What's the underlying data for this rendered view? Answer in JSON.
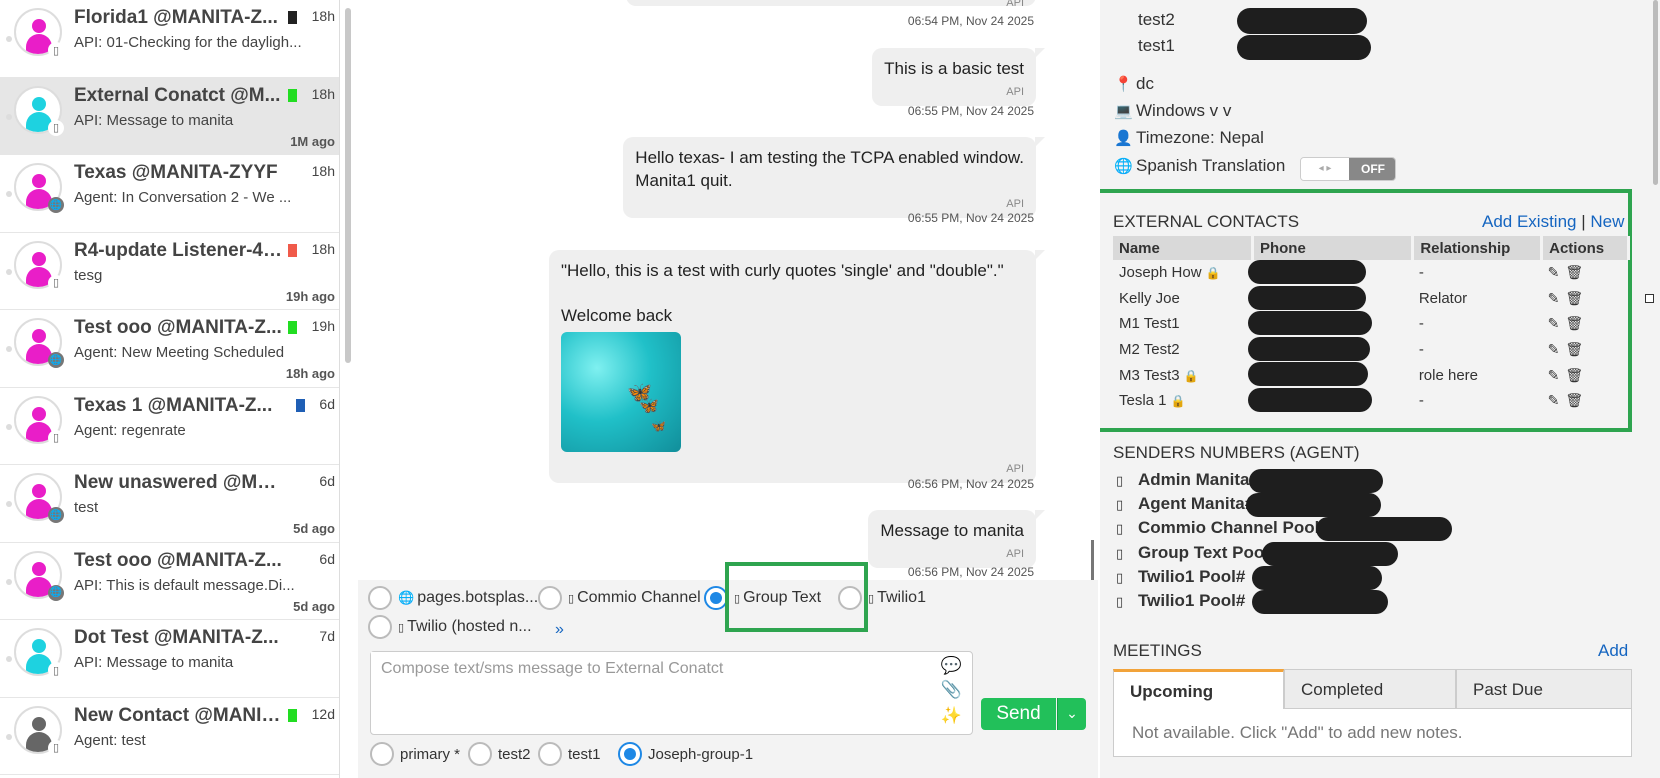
{
  "conversations": [
    {
      "title": "Florida1 @MANITA-Z...",
      "preview": "API: 01-Checking for the dayligh...",
      "time": "18h",
      "ago": "",
      "avatar_color": "#e91ec8",
      "flag_color": "#222222",
      "channel_icon": "phone-icon",
      "active": false
    },
    {
      "title": "External Conatct @M...",
      "preview": "API: Message to manita",
      "time": "18h",
      "ago": "1M ago",
      "avatar_color": "#1ed2e0",
      "flag_color": "#22dd22",
      "channel_icon": "phone-icon",
      "active": true
    },
    {
      "title": "Texas @MANITA-ZYYF",
      "preview": "Agent: In Conversation 2 - We ...",
      "time": "18h",
      "ago": "",
      "avatar_color": "#e91ec8",
      "flag_color": "",
      "channel_icon": "globe-icon",
      "active": false
    },
    {
      "title": "R4-update Listener-4 ...",
      "preview": "tesg",
      "time": "18h",
      "ago": "19h ago",
      "avatar_color": "#e91ec8",
      "flag_color": "#f05a4a",
      "channel_icon": "phone-icon",
      "active": false
    },
    {
      "title": "Test ooo @MANITA-Z...",
      "preview": "Agent: New Meeting Scheduled",
      "time": "19h",
      "ago": "18h ago",
      "avatar_color": "#e91ec8",
      "flag_color": "#22dd22",
      "channel_icon": "globe-icon",
      "active": false
    },
    {
      "title": "Texas 1 @MANITA-Z...",
      "preview": "Agent: regenrate",
      "time": "6d",
      "ago": "",
      "avatar_color": "#e91ec8",
      "flag_color": "#1f5fb5",
      "channel_icon": "phone-icon",
      "active": false
    },
    {
      "title": "New unaswered @MA...",
      "preview": "test",
      "time": "6d",
      "ago": "5d ago",
      "avatar_color": "#e91ec8",
      "flag_color": "",
      "channel_icon": "globe-icon",
      "active": false
    },
    {
      "title": "Test ooo @MANITA-Z...",
      "preview": "API: This is default message.Di...",
      "time": "6d",
      "ago": "5d ago",
      "avatar_color": "#e91ec8",
      "flag_color": "",
      "channel_icon": "globe-icon",
      "active": false
    },
    {
      "title": "Dot Test @MANITA-Z...",
      "preview": "API: Message to manita",
      "time": "7d",
      "ago": "",
      "avatar_color": "#1ed2e0",
      "flag_color": "",
      "channel_icon": "phone-icon",
      "active": false
    },
    {
      "title": "New Contact @MANIT...",
      "preview": "Agent: test",
      "time": "12d",
      "ago": "",
      "avatar_color": "#666666",
      "flag_color": "#22dd22",
      "channel_icon": "phone-icon",
      "active": false
    }
  ],
  "messages": {
    "m0": {
      "api": "API",
      "stamp": "06:54 PM, Nov 24 2025"
    },
    "m1": {
      "text": "This is a basic test",
      "api": "API",
      "stamp": "06:55 PM, Nov 24 2025"
    },
    "m2": {
      "line1": "Hello texas- I am testing the TCPA enabled window.",
      "line2": "Manita1 quit.",
      "api": "API",
      "stamp": "06:55 PM, Nov 24 2025"
    },
    "m3": {
      "line1": "\"Hello, this is a test with curly quotes 'single' and \"double\".\"",
      "line2": "Welcome back",
      "api": "API",
      "stamp": "06:56 PM, Nov 24 2025"
    },
    "m4": {
      "text": "Message to manita",
      "api": "API",
      "stamp": "06:56 PM, Nov 24 2025"
    }
  },
  "channels": [
    {
      "label": "pages.botsplas...",
      "icon": "globe-icon",
      "selected": false
    },
    {
      "label": "Commio Channel",
      "icon": "phone-icon",
      "selected": false
    },
    {
      "label": "Group Text",
      "icon": "phone-icon",
      "selected": true
    },
    {
      "label": "Twilio1",
      "icon": "phone-icon",
      "selected": false
    },
    {
      "label": "Twilio (hosted n...",
      "icon": "phone-icon",
      "selected": false
    }
  ],
  "more_channels": "»",
  "compose": {
    "placeholder": "Compose text/sms message to External Conatct",
    "send_label": "Send",
    "dropdown": "⌄"
  },
  "numbers": [
    {
      "label": "primary *",
      "selected": false
    },
    {
      "label": "test2",
      "selected": false
    },
    {
      "label": "test1",
      "selected": false
    },
    {
      "label": "Joseph-group-1",
      "selected": true
    }
  ],
  "profile": {
    "phones": [
      "test2",
      "test1"
    ],
    "location": "dc",
    "os": "Windows v v",
    "timezone": "Timezone: Nepal",
    "translation_label": "Spanish Translation",
    "translation_state": "OFF",
    "toggle_arrows": "◂ ▸"
  },
  "external_contacts": {
    "title": "EXTERNAL CONTACTS",
    "add_existing": "Add Existing",
    "separator": "|",
    "new": "New",
    "columns": [
      "Name",
      "Phone",
      "Relationship",
      "Actions"
    ],
    "rows": [
      {
        "name": "Joseph How",
        "locked": true,
        "relationship": "-"
      },
      {
        "name": "Kelly Joe",
        "locked": false,
        "relationship": "Relator"
      },
      {
        "name": "M1 Test1",
        "locked": false,
        "relationship": "-"
      },
      {
        "name": "M2 Test2",
        "locked": false,
        "relationship": "-"
      },
      {
        "name": "M3 Test3",
        "locked": true,
        "relationship": "role here"
      },
      {
        "name": "Tesla 1",
        "locked": true,
        "relationship": "-"
      }
    ]
  },
  "senders": {
    "title": "SENDERS NUMBERS (AGENT)",
    "items": [
      "Admin Manita#",
      "Agent Manita#",
      "Commio Channel Pool#",
      "Group Text Pool#",
      "Twilio1 Pool#",
      "Twilio1 Pool#"
    ]
  },
  "meetings": {
    "title": "MEETINGS",
    "add": "Add",
    "tabs": [
      "Upcoming",
      "Completed",
      "Past Due"
    ],
    "empty": "Not available. Click \"Add\" to add new notes."
  },
  "colors": {
    "highlight": "#2ea44f",
    "send": "#22c05a",
    "radio_on": "#1e88e5",
    "link": "#1565c0"
  }
}
